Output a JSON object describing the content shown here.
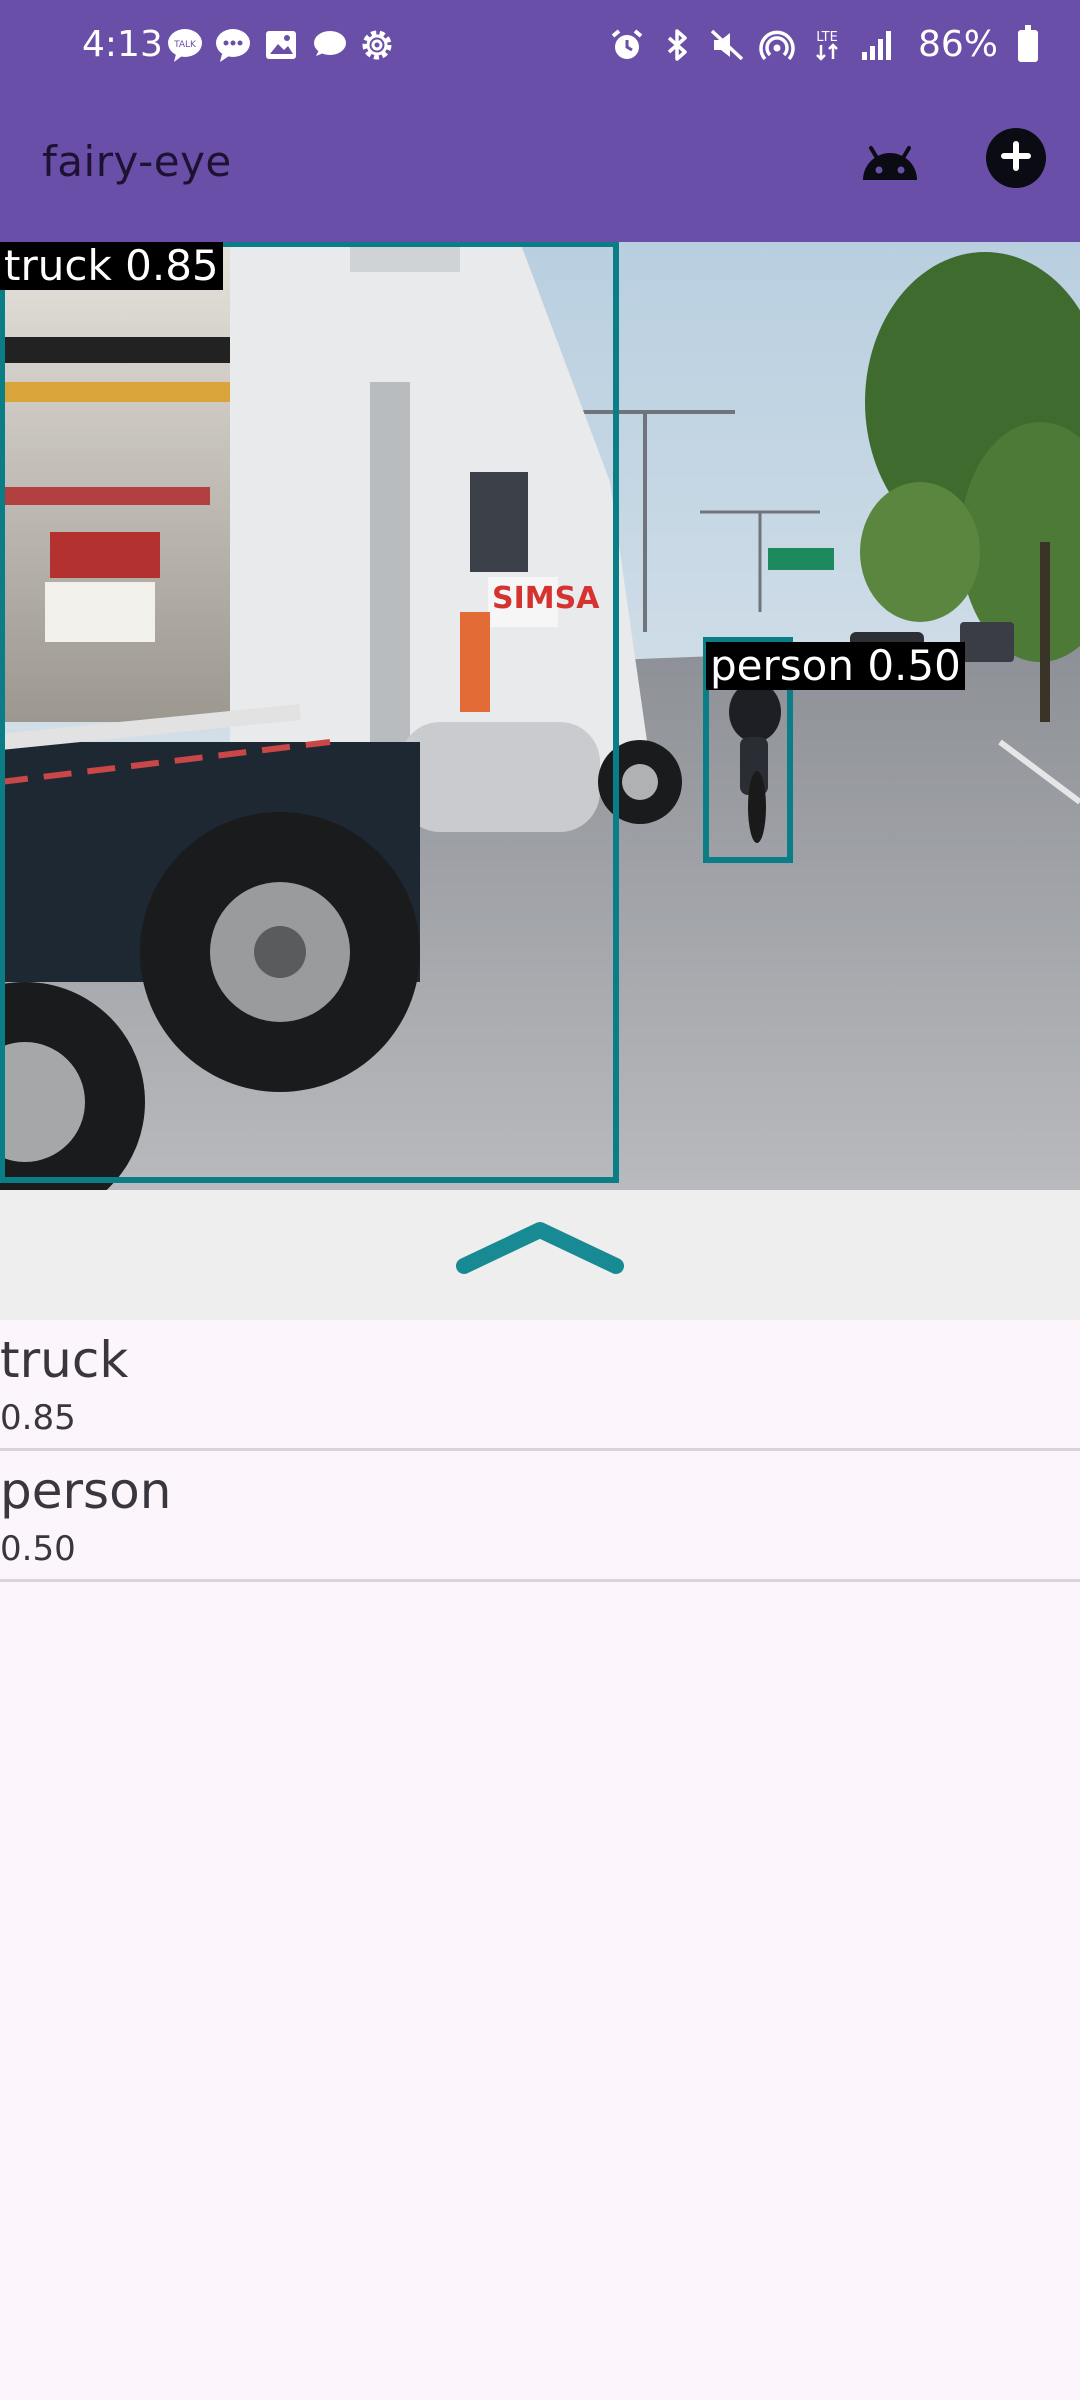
{
  "status_bar": {
    "time": "4:13",
    "left_icons": [
      "talk-icon",
      "messages-icon",
      "gallery-icon",
      "cloud-chat-icon",
      "settings-gear-icon"
    ],
    "right_icons": [
      "alarm-icon",
      "bluetooth-icon",
      "mute-icon",
      "hotspot-icon",
      "lte-icon",
      "signal-icon"
    ],
    "battery": "86%"
  },
  "app_bar": {
    "title": "fairy-eye",
    "android_icon": "android-icon",
    "add_icon": "add-circle-icon",
    "color": "#6a4fa8"
  },
  "detections": [
    {
      "label": "truck 0.85",
      "box_color": "#0b7d86"
    },
    {
      "label": "person 0.50",
      "box_color": "#0b7d86"
    }
  ],
  "sheet": {
    "handle_icon": "chevron-up-icon",
    "accent": "#178a93"
  },
  "results": [
    {
      "label": "truck",
      "score": "0.85"
    },
    {
      "label": "person",
      "score": "0.50"
    }
  ]
}
